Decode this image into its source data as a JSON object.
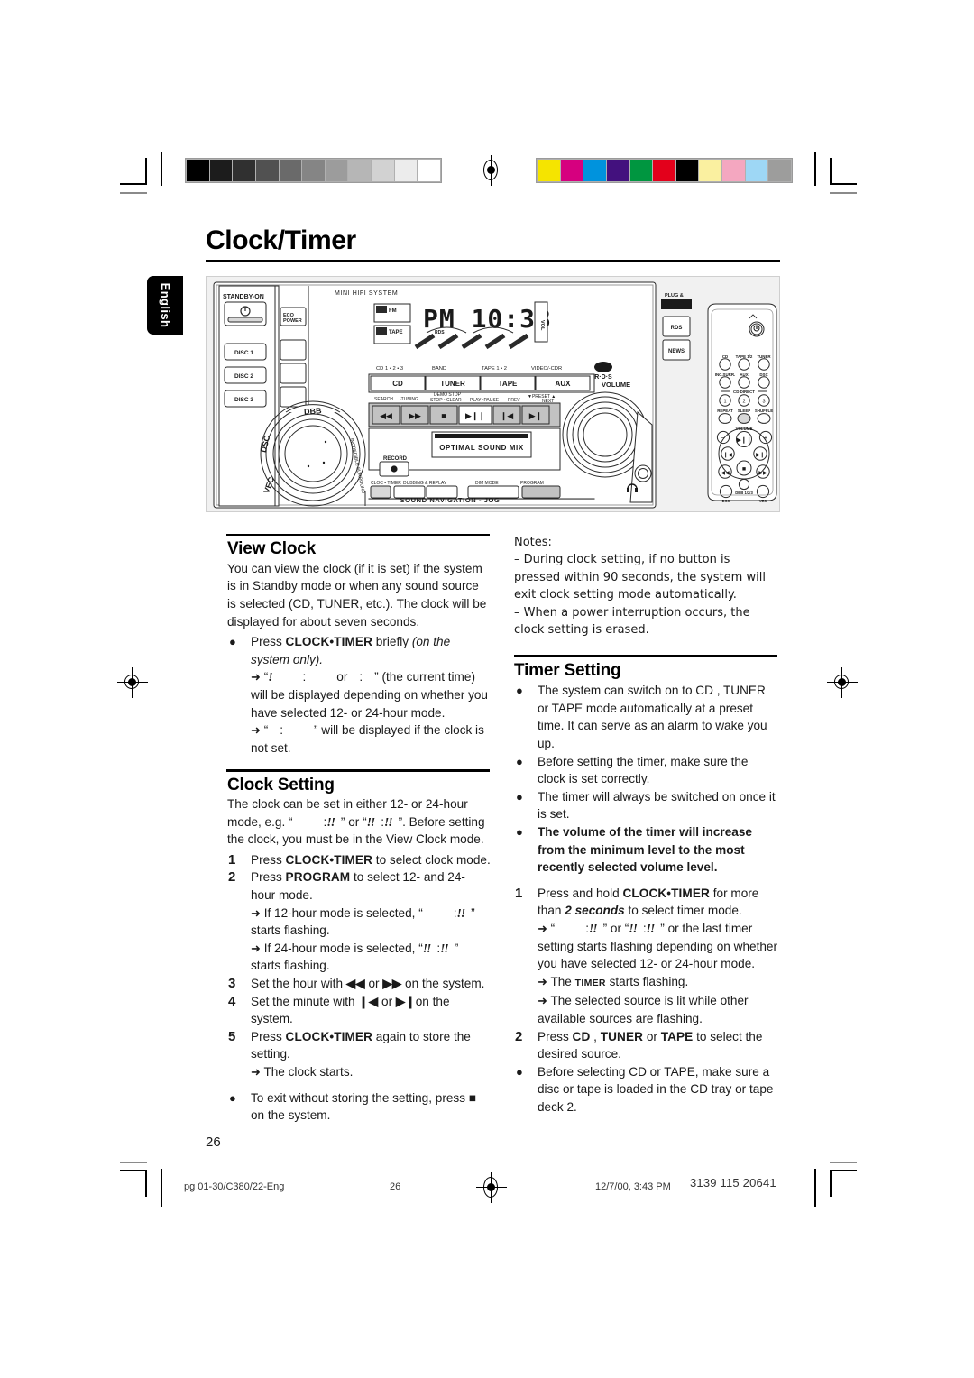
{
  "document": {
    "title": "Clock/Timer",
    "language_tab": "English",
    "page_number": "26"
  },
  "printer_marks": {
    "grayscale_swatches": [
      "#000000",
      "#1c1c1c",
      "#303030",
      "#515151",
      "#6a6a6a",
      "#858585",
      "#9c9c9c",
      "#b6b6b6",
      "#d2d2d2",
      "#ececec",
      "#ffffff"
    ],
    "color_swatches": [
      "#f5e400",
      "#d6007f",
      "#0093dd",
      "#43117e",
      "#009640",
      "#e3001b",
      "#000000",
      "#faf0a0",
      "#f4a7c0",
      "#9ed7f5",
      "#9d9d9c"
    ]
  },
  "illustration": {
    "caption_brand": "MINI HIFI SYSTEM",
    "standby_label": "STANDBY-ON",
    "eco_power": "ECO POWER",
    "disc_buttons": [
      "DISC 1",
      "DISC 2",
      "DISC 3"
    ],
    "display_time": "PM 10:38",
    "display_rds": "RDS",
    "source_sublabels": [
      "CD 1 • 2 • 3",
      "BAND",
      "TAPE 1 • 2",
      "VIDEO/-CDR"
    ],
    "source_buttons": [
      "CD",
      "TUNER",
      "TAPE",
      "AUX"
    ],
    "volume_label": "VOLUME",
    "transport_sublabels": [
      "SEARCH",
      "-TUNING",
      "DEMO STOP",
      "STOP • CLEAR",
      "PLAY •PAUSE",
      "PREV",
      "PRESET",
      "NEXT"
    ],
    "optimal_sound_mix": "OPTIMAL SOUND MIX",
    "record_label": "RECORD",
    "bottom_button_labels": [
      "CLOCK • TIMER",
      "DUBBING & REPLAY",
      "DIM MODE",
      "PROGRAM"
    ],
    "jog_label": "SOUND NAVIGATION - JOG",
    "knob_labels": [
      "DBB",
      "DSC",
      "VEC",
      "INCREDIBLE SURROUND"
    ],
    "cd_rds_logo": "CD RDS",
    "plug_and_play": "PLUG & PLAY",
    "side_buttons": [
      "RDS",
      "NEWS"
    ],
    "headphone_icon": "headphone-icon",
    "remote": {
      "power_icon": "power-icon",
      "row1": [
        "CD",
        "TAPE 1/2",
        "TUNER"
      ],
      "row2": [
        "INC.SURR.",
        "AUX",
        "DSC"
      ],
      "cd_direct_label": "CD DIRECT",
      "cd_direct": [
        "1",
        "2",
        "3"
      ],
      "row3": [
        "REPEAT",
        "SLEEP",
        "SHUFFLE"
      ],
      "volume_label": "VOLUME",
      "volume_minus": "−",
      "volume_plus": "+",
      "play_pause": "play-pause-icon",
      "prev": "prev-icon",
      "next": "next-icon",
      "rewind": "rewind-icon",
      "forward": "forward-icon",
      "stop": "stop-icon",
      "bottom": [
        "DSC",
        "DBB 1/2/3",
        "VEC"
      ]
    }
  },
  "left_column": {
    "view_clock": {
      "heading": "View Clock",
      "body": "You can view the clock (if it is set) if the system is in Standby mode or when any sound source is selected (CD, TUNER, etc.).  The clock will be displayed for about seven seconds.",
      "bullet": {
        "marker": "●",
        "text_before": "Press ",
        "key": "CLOCK•TIMER",
        "text_after": " briefly ",
        "italic": "(on the system only)."
      },
      "arrow1_pre": "“",
      "arrow1_glyph_a": "!",
      "arrow1_mid": "or",
      "arrow1_post": "” (the current time) will be displayed depending on whether you have selected 12- or 24-hour mode.",
      "arrow2_pre": "“",
      "arrow2_post": "” will be displayed if the clock is not set."
    },
    "clock_setting": {
      "heading": "Clock Setting",
      "body_a": "The clock can be set in either 12- or 24-hour mode, e.g. ",
      "body_b": "”. Before setting the clock, you must be in the View Clock mode.",
      "steps": [
        {
          "num": "1",
          "pre": "Press ",
          "key": "CLOCK•TIMER",
          "post": " to select clock mode."
        },
        {
          "num": "2",
          "pre": "Press ",
          "key": "PROGRAM",
          "post": " to select 12- and 24- hour mode."
        }
      ],
      "sub2_arrow1_pre": "If 12-hour mode is selected, “",
      "sub2_arrow1_post": "” starts flashing.",
      "sub2_arrow2_pre": "If 24-hour mode is selected, “",
      "sub2_arrow2_post": "” starts flashing.",
      "step3": {
        "num": "3",
        "pre": "Set the hour with ",
        "mid": " or ",
        "post": " on the system."
      },
      "step4": {
        "num": "4",
        "pre": "Set the minute with ",
        "mid": " or ",
        "post": "on the system."
      },
      "step5": {
        "num": "5",
        "pre": "Press ",
        "key": "CLOCK•TIMER",
        "post": " again to store the setting."
      },
      "step5_arrow": "The clock starts.",
      "exit_bullet_pre": "To exit without storing the setting, press ",
      "exit_bullet_post": " on the system."
    }
  },
  "right_column": {
    "notes": {
      "heading": "Notes:",
      "items": [
        "–  During clock setting,  if no button is pressed within 90 seconds, the system will exit clock setting mode automatically.",
        "–  When a power interruption occurs, the clock setting is erased."
      ]
    },
    "timer_setting": {
      "heading": "Timer Setting",
      "bullets": [
        "The system can switch on to CD , TUNER or TAPE mode automatically at a preset time. It can serve as an alarm to wake you up.",
        "Before setting the timer, make sure the clock is set correctly.",
        "The timer will always be switched on once it is set."
      ],
      "bold_bullet": "The volume of the timer will increase from the minimum level to the most recently selected volume level.",
      "step1": {
        "num": "1",
        "pre": "Press and hold ",
        "key": "CLOCK•TIMER",
        "mid": " for more than ",
        "bold_italic": "2 seconds",
        "post": " to select timer mode."
      },
      "step1_arrow1_post": "” or the last timer setting starts flashing depending on whether you have selected 12- or 24-hour mode.",
      "step1_arrow2_pre": "The ",
      "step1_arrow2_key": "TIMER",
      "step1_arrow2_post": " starts flashing.",
      "step1_arrow3": "The selected source is lit while other available sources are flashing.",
      "step2": {
        "num": "2",
        "pre": "Press ",
        "k1": "CD",
        "sep1": " , ",
        "k2": "TUNER",
        "sep2": " or ",
        "k3": "TAPE",
        "post": " to select the desired source."
      },
      "last_bullet": "Before selecting CD or TAPE, make sure a disc or tape is loaded in the CD tray or tape deck 2."
    }
  },
  "footer": {
    "file": "pg  01-30/C380/22-Eng",
    "page": "26",
    "date": "12/7/00, 3:43 PM",
    "code": "3139 115 20641"
  }
}
